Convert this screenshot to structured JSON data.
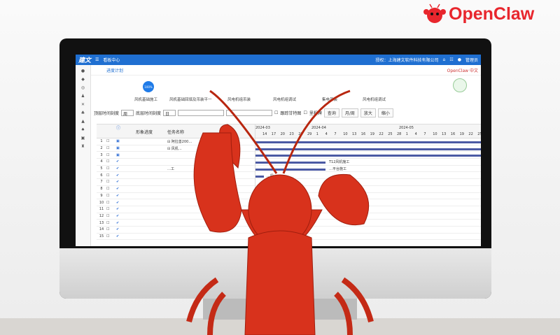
{
  "logo": {
    "text": "OpenClaw",
    "color": "#e8262d"
  },
  "screen": {
    "topbar": {
      "brand": "建文",
      "menu": "看板中心",
      "license": "授权：上海建文软件科技有限公司",
      "user": "管理员",
      "icons": [
        "home-icon",
        "org-icon",
        "chat-icon",
        "avatar-icon"
      ]
    },
    "breadcrumb": "进度计划",
    "openclaw_tag": "OpenClaw 中文",
    "progress": {
      "value": "100%",
      "percent": 100
    },
    "steps": [
      "风机基础施工",
      "风机基础回填及吊装平一",
      "风电机组吊装",
      "风电机组调试",
      "集电吊装",
      "风电机组调试"
    ],
    "toolbar": {
      "top_scale_label": "顶层时间刻度",
      "top_scale": "周",
      "bottom_scale_label": "底层时间刻度",
      "bottom_scale": "日",
      "follow_gantt": "跟踪甘特图",
      "milestone": "里程碑",
      "query": "查询",
      "month_week": "月/周",
      "zoom_in": "放大",
      "zoom_out": "缩小"
    },
    "columns": [
      "形象进度",
      "任务名称"
    ],
    "months": [
      "2024-03",
      "2024-04",
      "2024-05"
    ],
    "days": [
      "14",
      "17",
      "20",
      "23",
      "26",
      "29",
      "1",
      "4",
      "7",
      "10",
      "13",
      "16",
      "19",
      "22",
      "25",
      "28",
      "1",
      "4",
      "7",
      "10",
      "13",
      "16",
      "19",
      "22",
      "25"
    ],
    "rows": [
      {
        "n": "1",
        "name": "⊟ 阿拉善200…"
      },
      {
        "n": "2",
        "name": "⊟ 风机…"
      },
      {
        "n": "3",
        "name": ""
      },
      {
        "n": "4",
        "name": ""
      },
      {
        "n": "5",
        "name": "…工"
      },
      {
        "n": "6",
        "name": ""
      },
      {
        "n": "7",
        "name": ""
      },
      {
        "n": "8",
        "name": ""
      },
      {
        "n": "9",
        "name": ""
      },
      {
        "n": "10",
        "name": ""
      },
      {
        "n": "11",
        "name": ""
      },
      {
        "n": "12",
        "name": ""
      },
      {
        "n": "13",
        "name": ""
      },
      {
        "n": "14",
        "name": ""
      },
      {
        "n": "15",
        "name": ""
      }
    ],
    "bar_labels": [
      "T12风机施工",
      "…平台施工",
      "…段"
    ]
  }
}
